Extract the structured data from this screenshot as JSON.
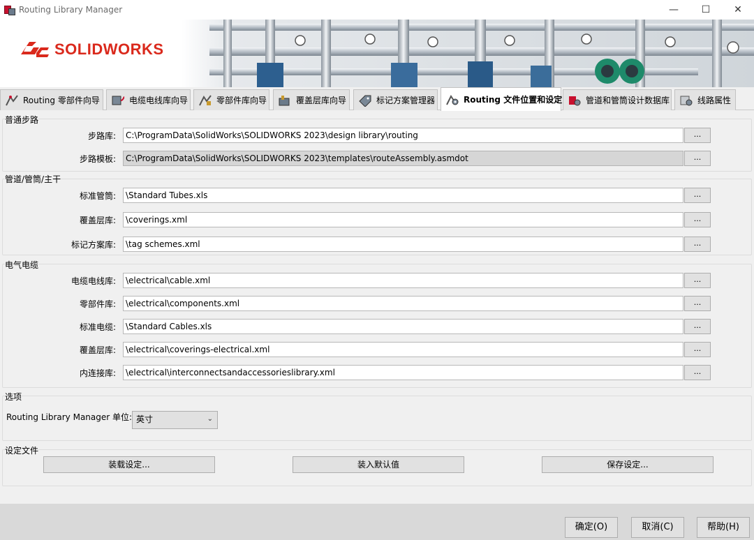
{
  "window": {
    "title": "Routing Library Manager",
    "minimize_glyph": "—",
    "maximize_glyph": "☐",
    "close_glyph": "✕"
  },
  "brand": {
    "logo_text": "SOLIDWORKS",
    "color": "#da291c"
  },
  "tabs": [
    {
      "label": "Routing 零部件向导",
      "icon": "routing-component-icon"
    },
    {
      "label": "电缆电线库向导",
      "icon": "cable-library-icon"
    },
    {
      "label": "零部件库向导",
      "icon": "component-library-icon"
    },
    {
      "label": "覆盖层库向导",
      "icon": "covering-library-icon"
    },
    {
      "label": "标记方案管理器",
      "icon": "tag-scheme-icon"
    },
    {
      "label": "Routing 文件位置和设定",
      "icon": "file-location-settings-icon",
      "active": true
    },
    {
      "label": "管道和管筒设计数据库",
      "icon": "pipe-database-icon"
    },
    {
      "label": "线路属性",
      "icon": "route-properties-icon"
    }
  ],
  "sections": {
    "general": {
      "title": "普通步路",
      "rows": [
        {
          "label": "步路库:",
          "value": "C:\\ProgramData\\SolidWorks\\SOLIDWORKS 2023\\design library\\routing",
          "readonly": false
        },
        {
          "label": "步路模板:",
          "value": "C:\\ProgramData\\SolidWorks\\SOLIDWORKS 2023\\templates\\routeAssembly.asmdot",
          "readonly": true
        }
      ]
    },
    "pipe": {
      "title": "管道/管筒/主干",
      "rows": [
        {
          "label": "标准管筒:",
          "value": "\\Standard Tubes.xls"
        },
        {
          "label": "覆盖层库:",
          "value": "\\coverings.xml"
        },
        {
          "label": "标记方案库:",
          "value": "\\tag schemes.xml"
        }
      ]
    },
    "electrical": {
      "title": "电气电缆",
      "rows": [
        {
          "label": "电缆电线库:",
          "value": "\\electrical\\cable.xml"
        },
        {
          "label": "零部件库:",
          "value": "\\electrical\\components.xml"
        },
        {
          "label": "标准电缆:",
          "value": "\\Standard Cables.xls"
        },
        {
          "label": "覆盖层库:",
          "value": "\\electrical\\coverings-electrical.xml"
        },
        {
          "label": "内连接库:",
          "value": "\\electrical\\interconnectsandaccessorieslibrary.xml"
        }
      ]
    },
    "options": {
      "title": "选项",
      "units_label": "Routing Library Manager 单位:",
      "units_value": "英寸"
    },
    "config": {
      "title": "设定文件",
      "load_label": "装载设定...",
      "defaults_label": "装入默认值",
      "save_label": "保存设定..."
    }
  },
  "browse_label": "...",
  "footer": {
    "ok_label": "确定(O)",
    "cancel_label": "取消(C)",
    "help_label": "帮助(H)"
  }
}
